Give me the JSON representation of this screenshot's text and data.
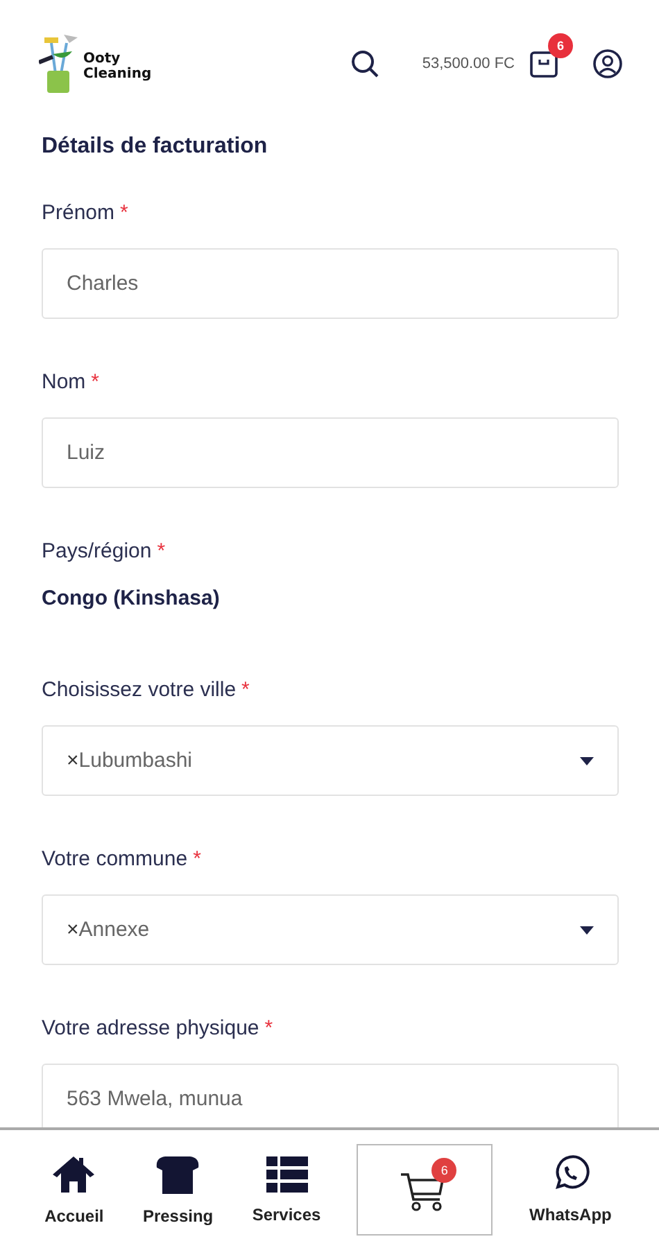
{
  "header": {
    "logo_lines": [
      "Ooty",
      "Cleaning"
    ],
    "cart_total": "53,500.00 FC",
    "cart_count": "6"
  },
  "section_title": "Détails de facturation",
  "fields": [
    {
      "kind": "text",
      "label": "Prénom",
      "required": true,
      "value": "Charles"
    },
    {
      "kind": "text",
      "label": "Nom",
      "required": true,
      "value": "Luiz"
    },
    {
      "kind": "static",
      "label": "Pays/région",
      "required": true,
      "value": "Congo (Kinshasa)"
    },
    {
      "kind": "select",
      "label": "Choisissez votre ville",
      "required": true,
      "clear": "×",
      "value": "Lubumbashi"
    },
    {
      "kind": "select",
      "label": "Votre commune",
      "required": true,
      "clear": "×",
      "value": "Annexe"
    },
    {
      "kind": "text",
      "label": "Votre adresse physique",
      "required": true,
      "value": "563 Mwela, munua"
    }
  ],
  "required_mark": "*",
  "bottom_nav": [
    {
      "kind": "home",
      "label": "Accueil",
      "selected": false
    },
    {
      "kind": "shirt",
      "label": "Pressing",
      "selected": false
    },
    {
      "kind": "list",
      "label": "Services",
      "selected": false
    },
    {
      "kind": "cart",
      "badge": "6",
      "selected": true
    },
    {
      "kind": "whatsapp",
      "label": "WhatsApp",
      "selected": false
    }
  ]
}
